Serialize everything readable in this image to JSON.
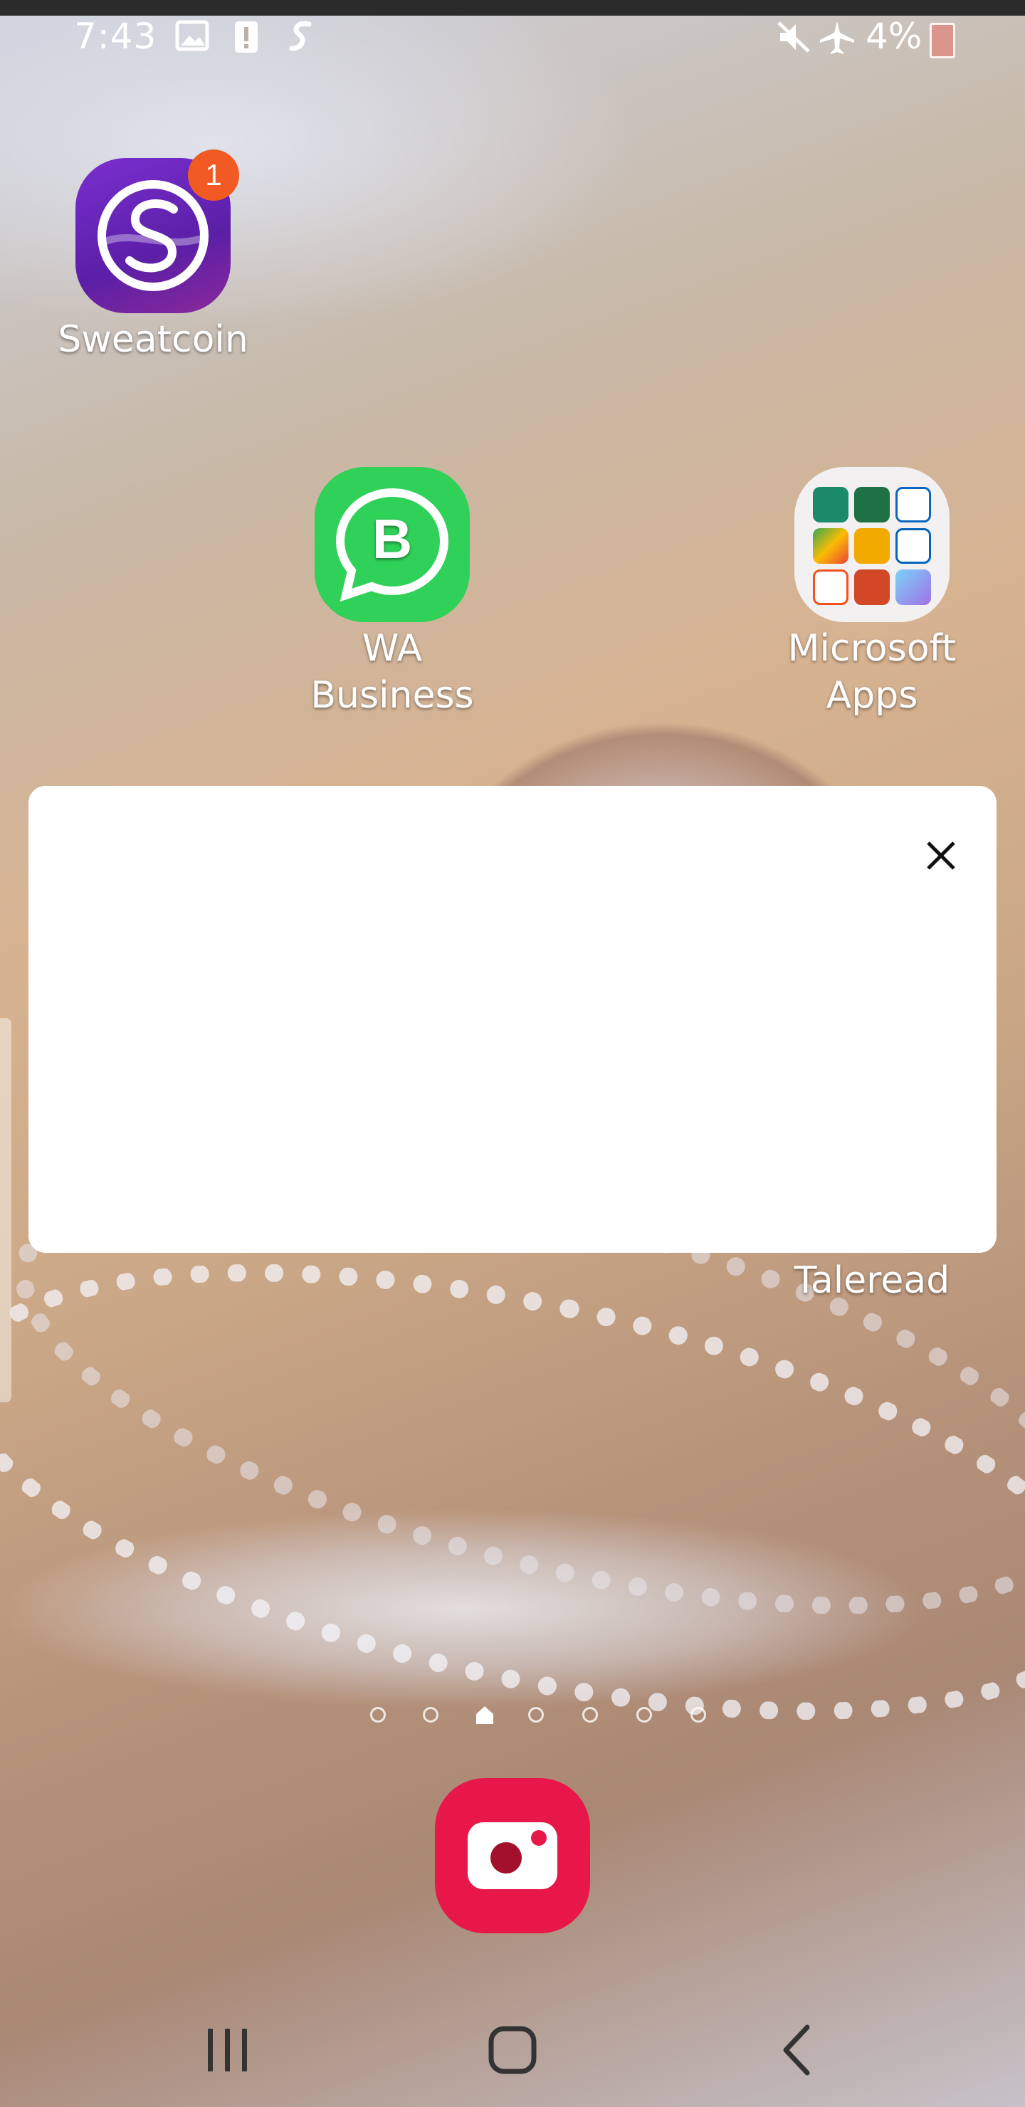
{
  "status_bar": {
    "time": "7:43",
    "battery_percent": "4%",
    "icons": [
      "gallery-icon",
      "alert-icon",
      "app-s-icon",
      "mute-icon",
      "airplane-icon",
      "battery-low-icon"
    ]
  },
  "apps": {
    "sweatcoin": {
      "label": "Sweatcoin",
      "badge": "1",
      "color": "#6a2bb8"
    },
    "wa_business": {
      "label_line1": "WA",
      "label_line2": "Business",
      "color": "#2fd158"
    },
    "microsoft_apps": {
      "label_line1": "Microsoft",
      "label_line2": "Apps"
    },
    "taleread": {
      "label": "Taleread"
    },
    "screen_recorder": {
      "color": "#e8174a"
    }
  },
  "dialog": {
    "close_icon": "close-icon"
  },
  "page_indicator": {
    "pages": 7,
    "current": 3
  },
  "navigation": {
    "buttons": [
      "recent-apps-icon",
      "home-icon",
      "back-icon"
    ]
  }
}
